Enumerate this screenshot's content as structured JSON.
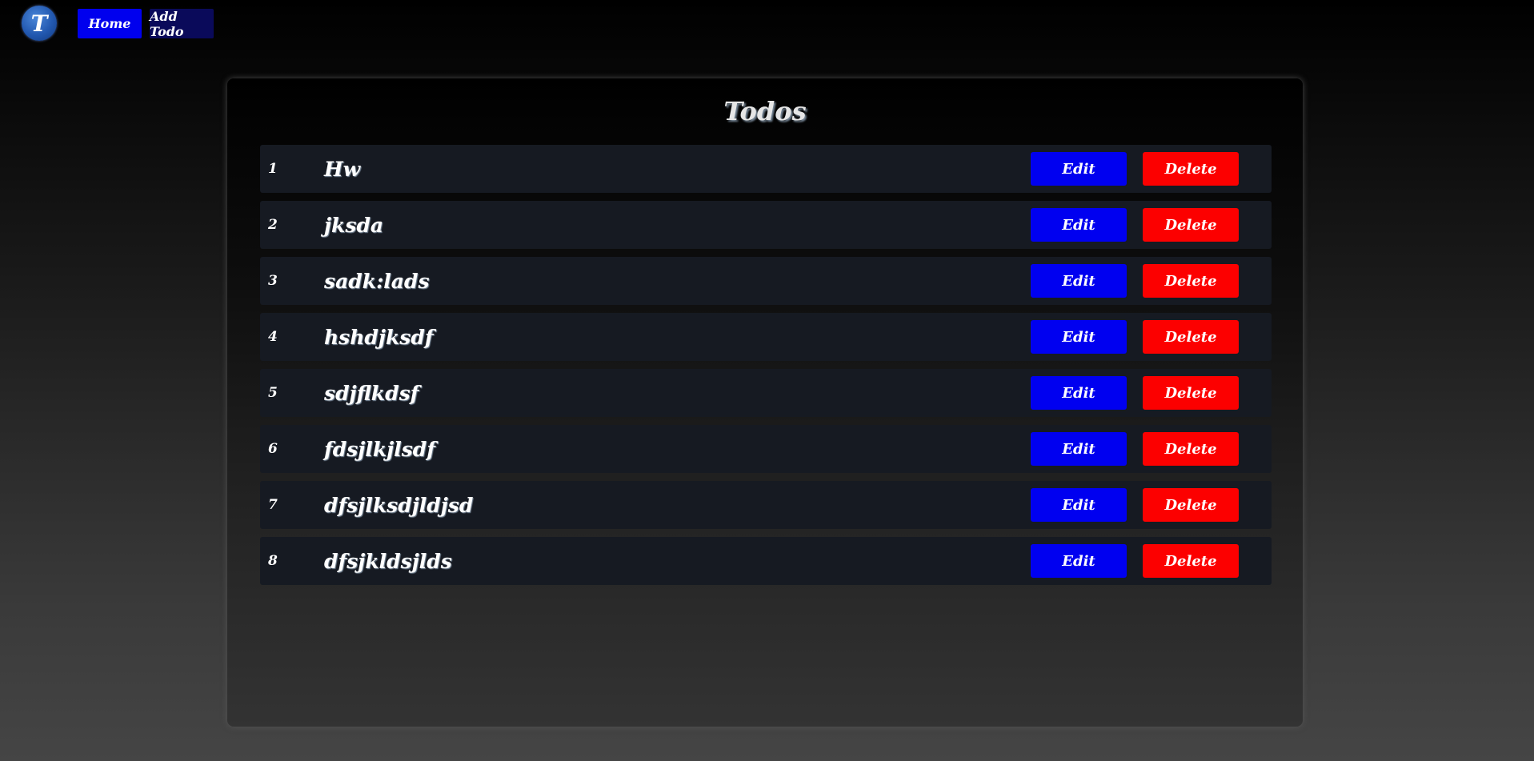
{
  "navbar": {
    "logo_letter": "T",
    "home_label": "Home",
    "add_todo_label": "Add Todo"
  },
  "colors": {
    "primary_blue": "#0000f0",
    "danger_red": "#fc0000",
    "row_bg": "#161a22"
  },
  "todos": {
    "title": "Todos",
    "edit_label": "Edit",
    "delete_label": "Delete",
    "items": [
      {
        "num": "1",
        "text": "Hw"
      },
      {
        "num": "2",
        "text": "jksda"
      },
      {
        "num": "3",
        "text": "sadk:lads"
      },
      {
        "num": "4",
        "text": "hshdjksdf"
      },
      {
        "num": "5",
        "text": "sdjflkdsf"
      },
      {
        "num": "6",
        "text": "fdsjlkjlsdf"
      },
      {
        "num": "7",
        "text": "dfsjlksdjldjsd"
      },
      {
        "num": "8",
        "text": "dfsjkldsjlds"
      }
    ]
  }
}
